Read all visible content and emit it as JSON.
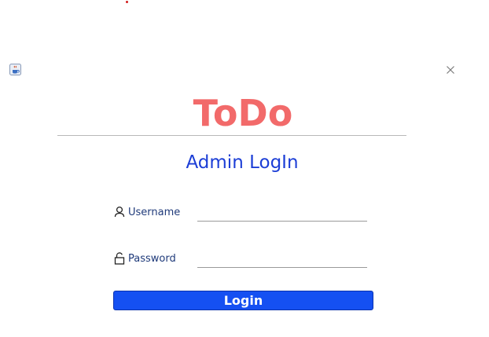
{
  "window": {
    "app_icon": "java-cup-icon",
    "close_icon": "close-icon"
  },
  "header": {
    "title": "ToDo",
    "subtitle": "Admin LogIn"
  },
  "form": {
    "username": {
      "icon": "user-icon",
      "label": "Username",
      "value": ""
    },
    "password": {
      "icon": "lock-icon",
      "label": "Password",
      "value": ""
    },
    "submit_label": "Login"
  },
  "colors": {
    "title": "#f26a6a",
    "subtitle": "#1c3ed6",
    "label": "#1f3a7a",
    "button": "#1550f2",
    "background": "#ffffff"
  }
}
